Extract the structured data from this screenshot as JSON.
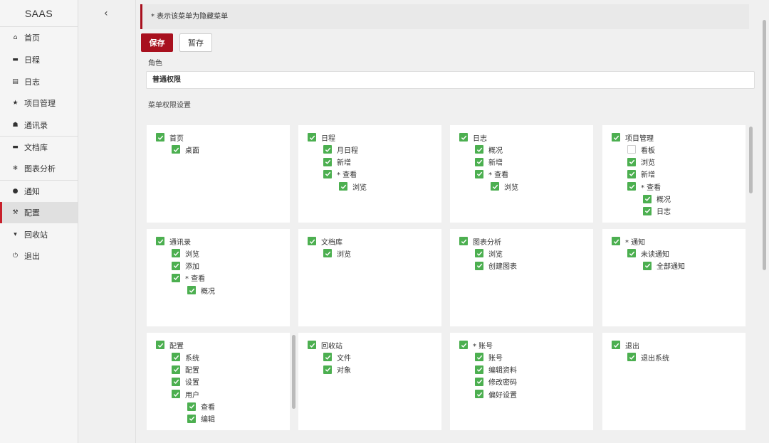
{
  "brand": "SAAS",
  "collapse_icon": "chevron-left-icon",
  "nav": [
    {
      "label": "首页",
      "icon": "home-icon",
      "glyph": "⌂",
      "sep": false,
      "active": false
    },
    {
      "label": "日程",
      "icon": "calendar-icon",
      "glyph": "▬",
      "sep": false,
      "active": false
    },
    {
      "label": "日志",
      "icon": "log-icon",
      "glyph": "▤",
      "sep": false,
      "active": false
    },
    {
      "label": "项目管理",
      "icon": "star-icon",
      "glyph": "★",
      "sep": false,
      "active": false
    },
    {
      "label": "通讯录",
      "icon": "contacts-icon",
      "glyph": "☗",
      "sep": false,
      "active": false
    },
    {
      "label": "文档库",
      "icon": "folder-icon",
      "glyph": "▬",
      "sep": true,
      "active": false
    },
    {
      "label": "图表分析",
      "icon": "chart-icon",
      "glyph": "❄",
      "sep": false,
      "active": false
    },
    {
      "label": "通知",
      "icon": "bell-icon",
      "glyph": "●",
      "sep": true,
      "active": false
    },
    {
      "label": "配置",
      "icon": "wrench-icon",
      "glyph": "⚒",
      "sep": false,
      "active": true
    },
    {
      "label": "回收站",
      "icon": "trash-icon",
      "glyph": "▾",
      "sep": false,
      "active": false
    },
    {
      "label": "退出",
      "icon": "power-icon",
      "glyph": "⏻",
      "sep": false,
      "active": false
    }
  ],
  "notice": "* 表示该菜单为隐藏菜单",
  "save_label": "保存",
  "temp_label": "暂存",
  "role_label": "角色",
  "role_value": "普通权限",
  "menu_label": "菜单权限设置",
  "cards": [
    {
      "items": [
        {
          "label": "首页",
          "level": 0,
          "checked": true
        },
        {
          "label": "桌面",
          "level": 1,
          "checked": true
        }
      ]
    },
    {
      "items": [
        {
          "label": "日程",
          "level": 0,
          "checked": true
        },
        {
          "label": "月日程",
          "level": 1,
          "checked": true
        },
        {
          "label": "新增",
          "level": 1,
          "checked": true
        },
        {
          "label": "* 查看",
          "level": 1,
          "checked": true
        },
        {
          "label": "浏览",
          "level": 2,
          "checked": true
        }
      ]
    },
    {
      "items": [
        {
          "label": "日志",
          "level": 0,
          "checked": true
        },
        {
          "label": "概况",
          "level": 1,
          "checked": true
        },
        {
          "label": "新增",
          "level": 1,
          "checked": true
        },
        {
          "label": "* 查看",
          "level": 1,
          "checked": true
        },
        {
          "label": "浏览",
          "level": 2,
          "checked": true
        }
      ]
    },
    {
      "items": [
        {
          "label": "项目管理",
          "level": 0,
          "checked": true
        },
        {
          "label": "看板",
          "level": 1,
          "checked": false
        },
        {
          "label": "浏览",
          "level": 1,
          "checked": true
        },
        {
          "label": "新增",
          "level": 1,
          "checked": true
        },
        {
          "label": "* 查看",
          "level": 1,
          "checked": true
        },
        {
          "label": "概况",
          "level": 2,
          "checked": true
        },
        {
          "label": "日志",
          "level": 2,
          "checked": true
        }
      ]
    },
    {
      "items": [
        {
          "label": "通讯录",
          "level": 0,
          "checked": true
        },
        {
          "label": "浏览",
          "level": 1,
          "checked": true
        },
        {
          "label": "添加",
          "level": 1,
          "checked": true
        },
        {
          "label": "* 查看",
          "level": 1,
          "checked": true
        },
        {
          "label": "概况",
          "level": 2,
          "checked": true
        }
      ]
    },
    {
      "items": [
        {
          "label": "文档库",
          "level": 0,
          "checked": true
        },
        {
          "label": "浏览",
          "level": 1,
          "checked": true
        }
      ]
    },
    {
      "items": [
        {
          "label": "图表分析",
          "level": 0,
          "checked": true
        },
        {
          "label": "浏览",
          "level": 1,
          "checked": true
        },
        {
          "label": "创建图表",
          "level": 1,
          "checked": true
        }
      ]
    },
    {
      "items": [
        {
          "label": "* 通知",
          "level": 0,
          "checked": true
        },
        {
          "label": "未读通知",
          "level": 1,
          "checked": true
        },
        {
          "label": "全部通知",
          "level": 2,
          "checked": true
        }
      ]
    },
    {
      "items": [
        {
          "label": "配置",
          "level": 0,
          "checked": true
        },
        {
          "label": "系统",
          "level": 1,
          "checked": true
        },
        {
          "label": "配置",
          "level": 1,
          "checked": true
        },
        {
          "label": "设置",
          "level": 1,
          "checked": true
        },
        {
          "label": "用户",
          "level": 1,
          "checked": true
        },
        {
          "label": "查看",
          "level": 2,
          "checked": true
        },
        {
          "label": "编辑",
          "level": 2,
          "checked": true
        }
      ]
    },
    {
      "items": [
        {
          "label": "回收站",
          "level": 0,
          "checked": true
        },
        {
          "label": "文件",
          "level": 1,
          "checked": true
        },
        {
          "label": "对象",
          "level": 1,
          "checked": true
        }
      ]
    },
    {
      "items": [
        {
          "label": "* 账号",
          "level": 0,
          "checked": true
        },
        {
          "label": "账号",
          "level": 1,
          "checked": true
        },
        {
          "label": "编辑资料",
          "level": 1,
          "checked": true
        },
        {
          "label": "修改密码",
          "level": 1,
          "checked": true
        },
        {
          "label": "偏好设置",
          "level": 1,
          "checked": true
        }
      ]
    },
    {
      "items": [
        {
          "label": "退出",
          "level": 0,
          "checked": true
        },
        {
          "label": "退出系统",
          "level": 1,
          "checked": true
        }
      ]
    }
  ],
  "colors": {
    "accent": "#a8101e",
    "check": "#4caf50"
  }
}
